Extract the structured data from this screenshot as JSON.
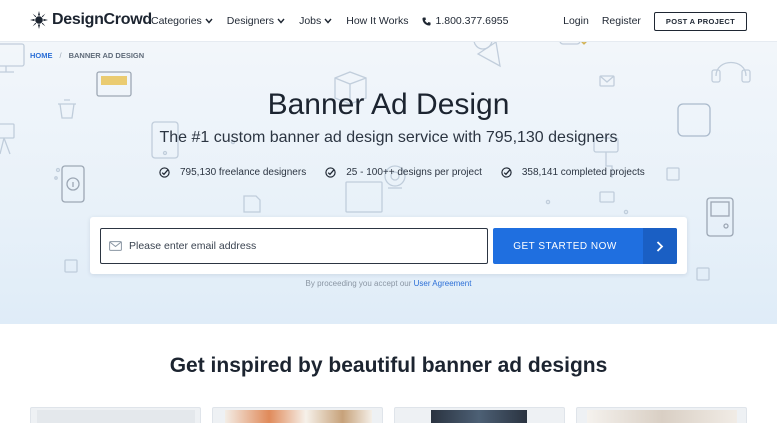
{
  "header": {
    "logo_text": "DesignCrowd",
    "nav": [
      {
        "label": "Categories",
        "has_dropdown": true
      },
      {
        "label": "Designers",
        "has_dropdown": true
      },
      {
        "label": "Jobs",
        "has_dropdown": true
      },
      {
        "label": "How It Works",
        "has_dropdown": false
      }
    ],
    "phone": "1.800.377.6955",
    "login": "Login",
    "register": "Register",
    "post_project": "POST A PROJECT"
  },
  "breadcrumb": {
    "home": "HOME",
    "separator": "/",
    "current": "BANNER AD DESIGN"
  },
  "hero": {
    "title": "Banner Ad Design",
    "subtitle": "The #1 custom banner ad design service with 795,130 designers",
    "stats": [
      "795,130 freelance designers",
      "25 - 100++ designs per project",
      "358,141 completed projects"
    ],
    "email_placeholder": "Please enter email address",
    "cta_label": "GET STARTED NOW",
    "agreement_prefix": "By proceeding you accept our",
    "agreement_link": "User Agreement"
  },
  "inspiration": {
    "title": "Get inspired by beautiful banner ad designs"
  },
  "colors": {
    "accent": "#1f6fe0",
    "accent_dark": "#1a5fc4",
    "link": "#2b6fd6",
    "text": "#1c2430"
  }
}
